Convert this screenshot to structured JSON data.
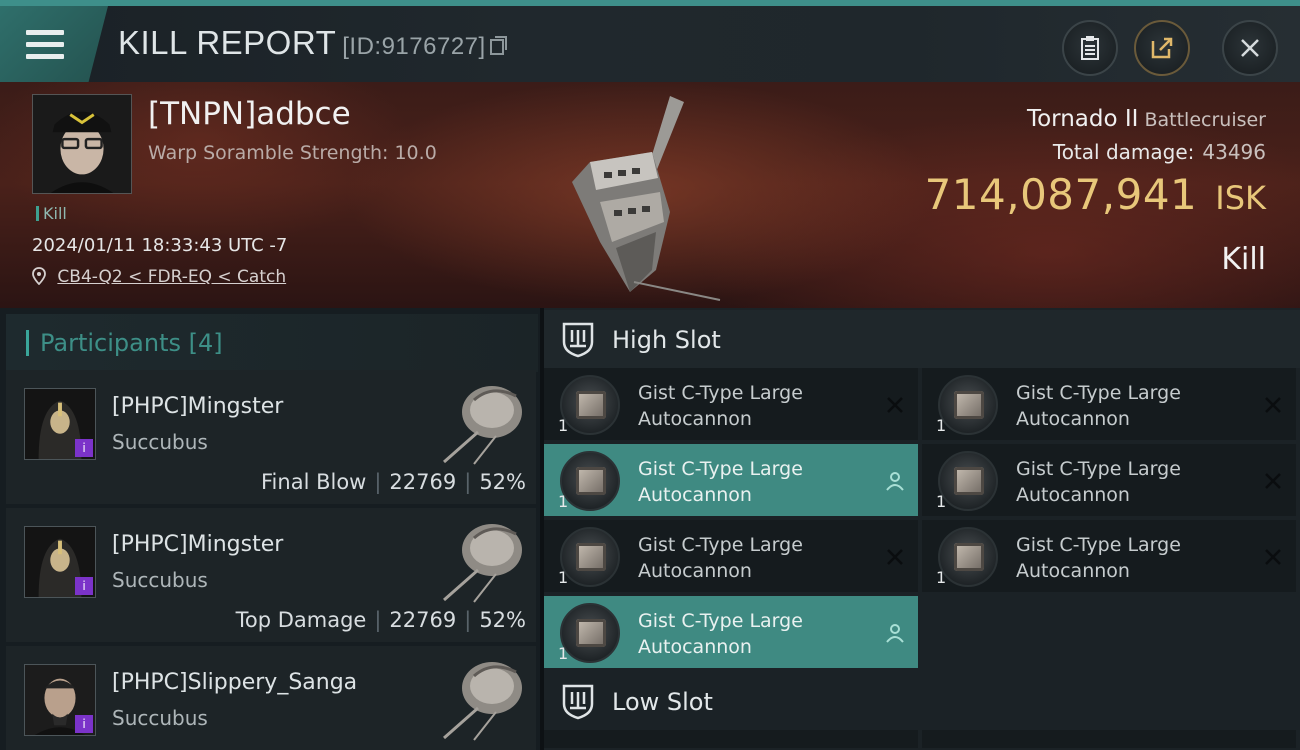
{
  "header": {
    "title": "KILL REPORT",
    "id_text": "[ID:9176727]"
  },
  "victim": {
    "name": "[TNPN]adbce",
    "detail": "Warp Soramble Strength: 10.0",
    "tag": "Kill",
    "datetime": "2024/01/11 18:33:43 UTC -7",
    "location": "CB4-Q2 < FDR-EQ < Catch",
    "ship_name": "Tornado II",
    "ship_class": "Battlecruiser",
    "total_damage_label": "Total damage:",
    "total_damage": "43496",
    "isk_value": "714,087,941",
    "isk_unit": "ISK",
    "result": "Kill"
  },
  "participants": {
    "label": "Participants",
    "count": "[4]",
    "items": [
      {
        "name": "[PHPC]Mingster",
        "ship": "Succubus",
        "tag": "Final Blow",
        "damage": "22769",
        "percent": "52%"
      },
      {
        "name": "[PHPC]Mingster",
        "ship": "Succubus",
        "tag": "Top Damage",
        "damage": "22769",
        "percent": "52%"
      },
      {
        "name": "[PHPC]Slippery_Sanga",
        "ship": "Succubus"
      }
    ]
  },
  "slots": {
    "high_label": "High Slot",
    "low_label": "Low Slot",
    "high_modules": [
      {
        "name": "Gist C-Type Large Autocannon",
        "qty": "1",
        "status": "destroyed"
      },
      {
        "name": "Gist C-Type Large Autocannon",
        "qty": "1",
        "status": "destroyed"
      },
      {
        "name": "Gist C-Type Large Autocannon",
        "qty": "1",
        "status": "dropped"
      },
      {
        "name": "Gist C-Type Large Autocannon",
        "qty": "1",
        "status": "destroyed"
      },
      {
        "name": "Gist C-Type Large Autocannon",
        "qty": "1",
        "status": "destroyed"
      },
      {
        "name": "Gist C-Type Large Autocannon",
        "qty": "1",
        "status": "destroyed"
      },
      {
        "name": "Gist C-Type Large Autocannon",
        "qty": "1",
        "status": "dropped"
      }
    ]
  },
  "colors": {
    "accent": "#3e8f8a",
    "isk": "#e8c77a",
    "dropped_bg": "#3f8a82",
    "alpha_badge": "#7b33c9"
  }
}
